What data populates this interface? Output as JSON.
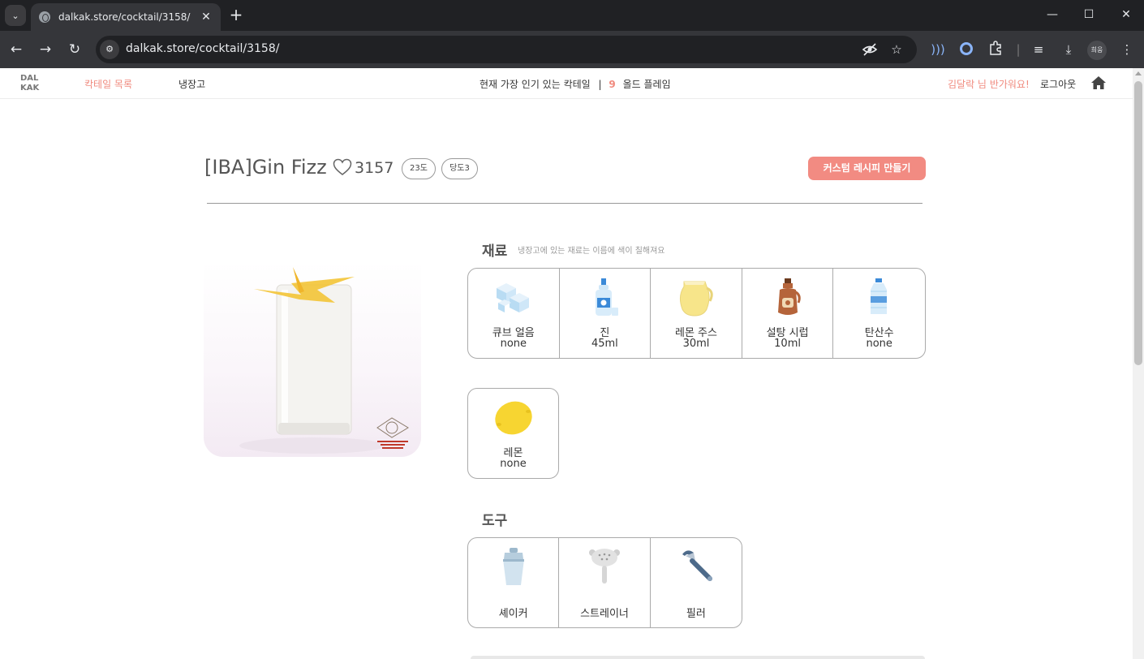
{
  "browser": {
    "tab_title": "dalkak.store/cocktail/3158/",
    "url": "dalkak.store/cocktail/3158/",
    "profile_label": "희웅"
  },
  "header": {
    "logo_line1": "DAL",
    "logo_line2": "KAK",
    "nav_cocktails": "칵테일 목록",
    "nav_fridge": "냉장고",
    "popular_label": "현재 가장 인기 있는 칵테일",
    "popular_separator": "|",
    "popular_rank": "9",
    "popular_name": "올드 플레임",
    "greeting": "김달락 님 반가워요!",
    "logout": "로그아웃"
  },
  "cocktail": {
    "title": "[IBA]Gin Fizz",
    "likes": "3157",
    "abv_tag": "23도",
    "sweet_tag": "당도3",
    "custom_button": "커스텀 레시피 만들기"
  },
  "ingredients": {
    "title": "재료",
    "hint": "냉장고에 있는 재료는 이름에 색이 칠해져요",
    "items": [
      {
        "icon": "ice-cube-icon",
        "name": "큐브 얼음",
        "amount": "none"
      },
      {
        "icon": "gin-bottle-icon",
        "name": "진",
        "amount": "45ml"
      },
      {
        "icon": "lemon-juice-pitcher-icon",
        "name": "레몬 주스",
        "amount": "30ml"
      },
      {
        "icon": "syrup-bottle-icon",
        "name": "설탕 시럽",
        "amount": "10ml"
      },
      {
        "icon": "soda-water-bottle-icon",
        "name": "탄산수",
        "amount": "none"
      },
      {
        "icon": "lemon-icon",
        "name": "레몬",
        "amount": "none"
      }
    ]
  },
  "tools": {
    "title": "도구",
    "items": [
      {
        "icon": "shaker-icon",
        "name": "셰이커"
      },
      {
        "icon": "strainer-icon",
        "name": "스트레이너"
      },
      {
        "icon": "peeler-icon",
        "name": "필러"
      }
    ]
  },
  "colors": {
    "accent": "#f08a7e",
    "button": "#f28b82",
    "chrome_dark": "#202124",
    "chrome_toolbar": "#35363a"
  }
}
